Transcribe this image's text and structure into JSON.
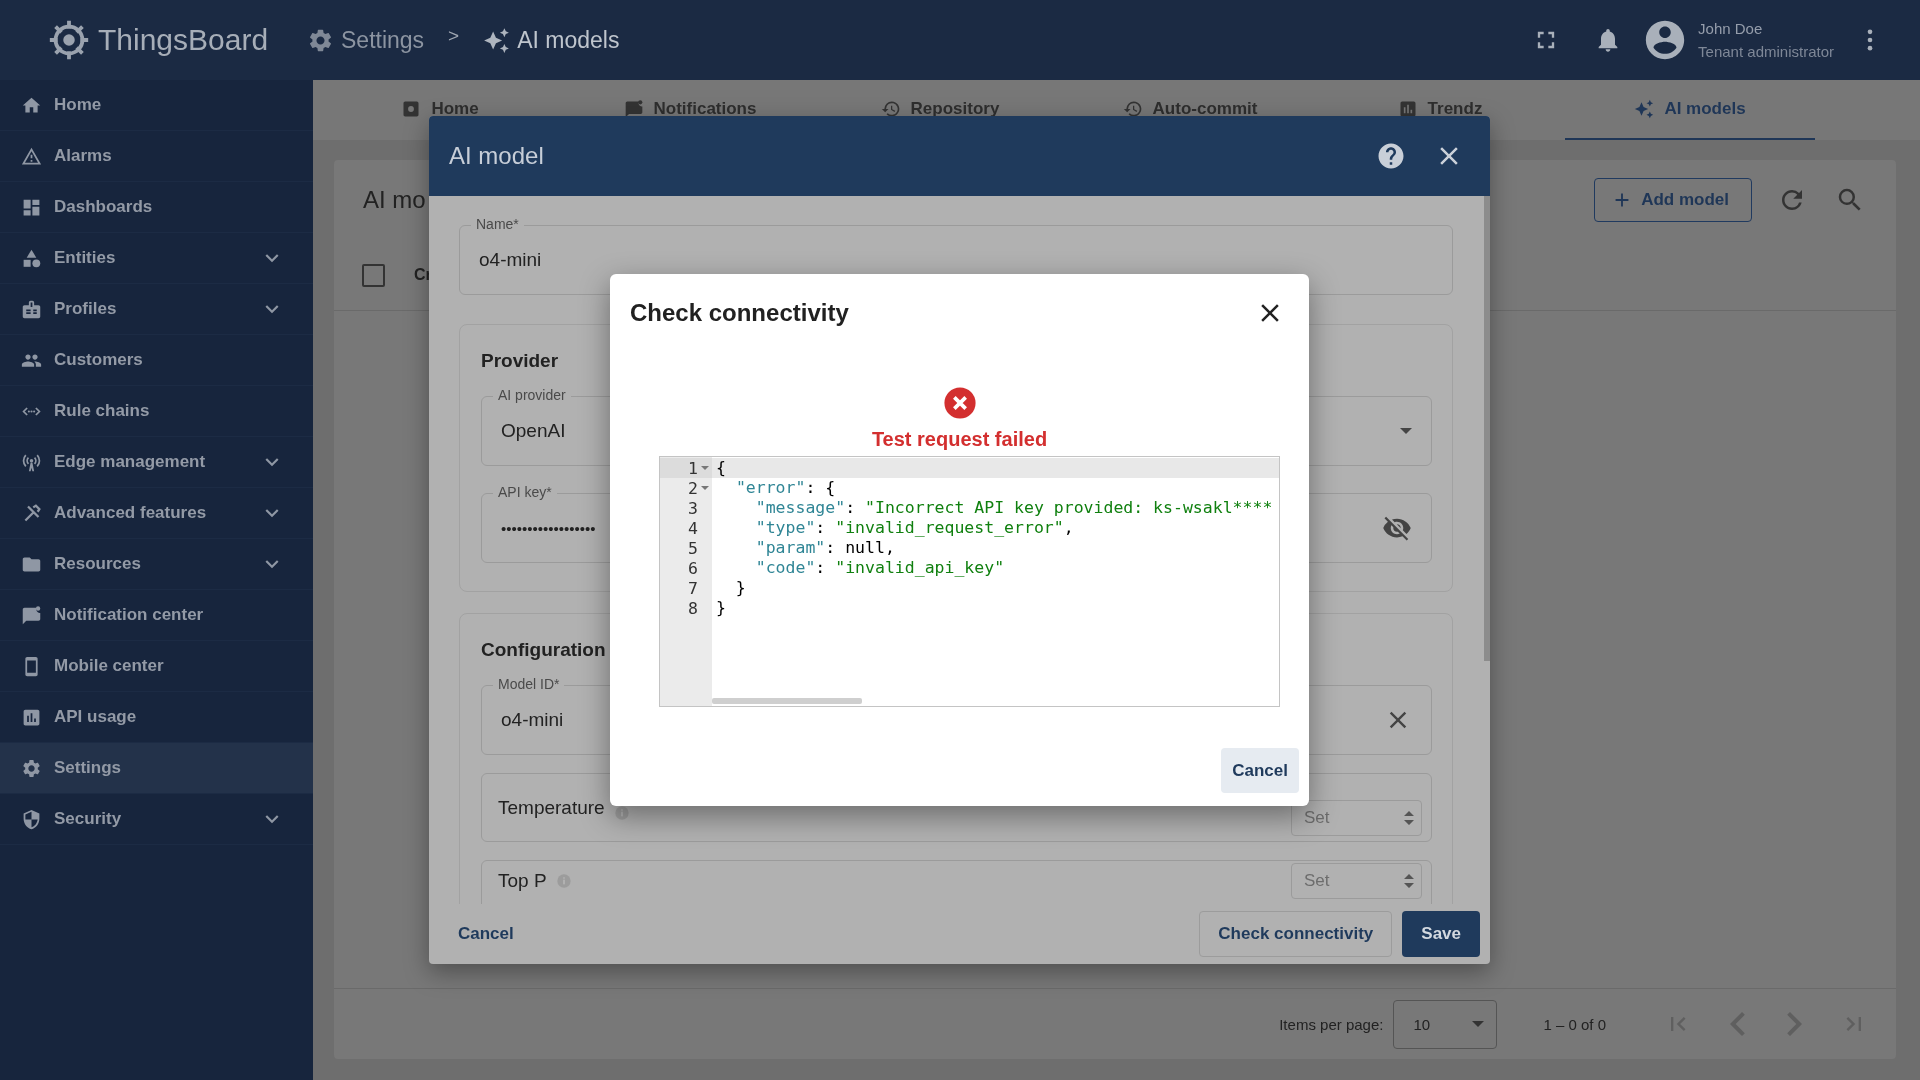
{
  "header": {
    "app_name": "ThingsBoard",
    "breadcrumb": [
      {
        "label": "Settings"
      },
      {
        "label": "AI models"
      }
    ],
    "separator": ">",
    "user": {
      "name": "John Doe",
      "role": "Tenant administrator"
    }
  },
  "sidebar": {
    "items": [
      {
        "label": "Home",
        "expandable": false,
        "selected": false
      },
      {
        "label": "Alarms",
        "expandable": false,
        "selected": false
      },
      {
        "label": "Dashboards",
        "expandable": false,
        "selected": false
      },
      {
        "label": "Entities",
        "expandable": true,
        "selected": false
      },
      {
        "label": "Profiles",
        "expandable": true,
        "selected": false
      },
      {
        "label": "Customers",
        "expandable": false,
        "selected": false
      },
      {
        "label": "Rule chains",
        "expandable": false,
        "selected": false
      },
      {
        "label": "Edge management",
        "expandable": true,
        "selected": false
      },
      {
        "label": "Advanced features",
        "expandable": true,
        "selected": false
      },
      {
        "label": "Resources",
        "expandable": true,
        "selected": false
      },
      {
        "label": "Notification center",
        "expandable": false,
        "selected": false
      },
      {
        "label": "Mobile center",
        "expandable": false,
        "selected": false
      },
      {
        "label": "API usage",
        "expandable": false,
        "selected": false
      },
      {
        "label": "Settings",
        "expandable": false,
        "selected": true
      },
      {
        "label": "Security",
        "expandable": true,
        "selected": false
      }
    ]
  },
  "tabs": [
    {
      "label": "Home",
      "selected": false
    },
    {
      "label": "Notifications",
      "selected": false
    },
    {
      "label": "Repository",
      "selected": false
    },
    {
      "label": "Auto-commit",
      "selected": false
    },
    {
      "label": "Trendz",
      "selected": false
    },
    {
      "label": "AI models",
      "selected": true
    }
  ],
  "page": {
    "title": "AI mo",
    "add_button": "Add model",
    "table": {
      "header_checkbox": {
        "checked": false
      },
      "column_1": "Cr"
    },
    "paginator": {
      "items_per_page_label": "Items per page:",
      "page_size": "10",
      "range": "1 – 0 of 0",
      "nav_buttons": [
        {
          "kind": "first",
          "disabled": true
        },
        {
          "kind": "previous",
          "disabled": true
        },
        {
          "kind": "next",
          "disabled": true
        },
        {
          "kind": "last",
          "disabled": true
        }
      ]
    }
  },
  "ai_model_dialog": {
    "title": "AI model",
    "name": {
      "label": "Name*",
      "value": "o4-mini"
    },
    "provider_section": {
      "title": "Provider",
      "ai_provider": {
        "label": "AI provider",
        "value": "OpenAI"
      },
      "api_key": {
        "label": "API key*",
        "value": "••••••••••••••••••"
      }
    },
    "configuration_section": {
      "title": "Configuration",
      "model_id": {
        "label": "Model ID*",
        "value": "o4-mini"
      },
      "parameters": [
        {
          "label": "Temperature",
          "placeholder": "Set"
        },
        {
          "label": "Top P",
          "placeholder": "Set"
        }
      ]
    },
    "actions": {
      "cancel": "Cancel",
      "check": "Check connectivity",
      "save": "Save"
    }
  },
  "check_dialog": {
    "title": "Check connectivity",
    "result": {
      "kind": "error",
      "message": "Test request failed"
    },
    "response": {
      "lines": [
        {
          "number": "1",
          "text": "{",
          "foldable": true,
          "active": true
        },
        {
          "number": "2",
          "text": "  \"error\": {",
          "foldable": true,
          "active": false
        },
        {
          "number": "3",
          "text": "    \"message\": \"Incorrect API key provided: ks-wsakl****",
          "foldable": false,
          "active": false
        },
        {
          "number": "4",
          "text": "    \"type\": \"invalid_request_error\",",
          "foldable": false,
          "active": false
        },
        {
          "number": "5",
          "text": "    \"param\": null,",
          "foldable": false,
          "active": false
        },
        {
          "number": "6",
          "text": "    \"code\": \"invalid_api_key\"",
          "foldable": false,
          "active": false
        },
        {
          "number": "7",
          "text": "  }",
          "foldable": false,
          "active": false
        },
        {
          "number": "8",
          "text": "}",
          "foldable": false,
          "active": false
        }
      ]
    },
    "cancel": "Cancel"
  }
}
